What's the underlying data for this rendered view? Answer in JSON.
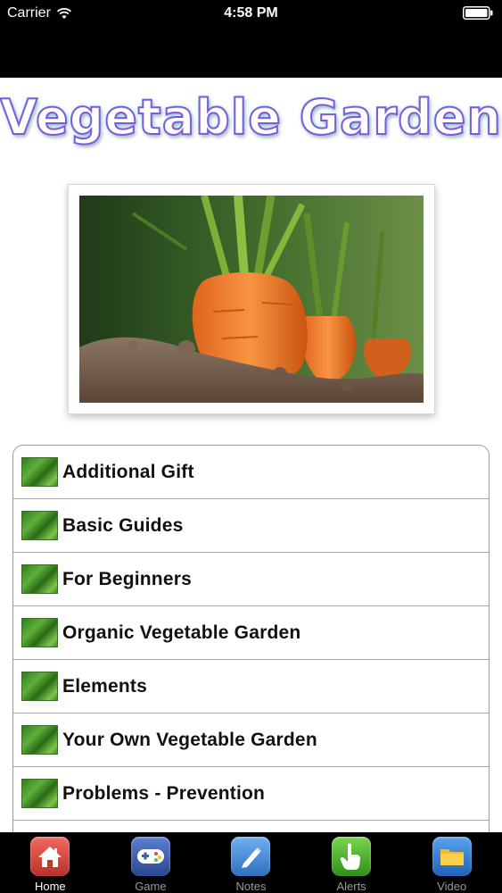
{
  "status_bar": {
    "carrier": "Carrier",
    "time": "4:58 PM"
  },
  "header": {
    "title": "Vegetable Garden"
  },
  "menu": {
    "items": [
      {
        "label": "Additional Gift",
        "icon": "garden-thumbnail"
      },
      {
        "label": "Basic Guides",
        "icon": "garden-thumbnail"
      },
      {
        "label": "For Beginners",
        "icon": "garden-thumbnail"
      },
      {
        "label": "Organic Vegetable Garden",
        "icon": "garden-thumbnail"
      },
      {
        "label": "Elements",
        "icon": "garden-thumbnail"
      },
      {
        "label": "Your Own Vegetable Garden",
        "icon": "garden-thumbnail"
      },
      {
        "label": "Problems - Prevention",
        "icon": "garden-thumbnail"
      }
    ]
  },
  "tab_bar": {
    "tabs": [
      {
        "label": "Home",
        "icon": "house-icon",
        "color": "#d9423a",
        "active": true
      },
      {
        "label": "Game",
        "icon": "gamepad-icon",
        "color": "#3b5fb0",
        "active": false
      },
      {
        "label": "Notes",
        "icon": "pen-icon",
        "color": "#3f86d6",
        "active": false
      },
      {
        "label": "Alerts",
        "icon": "hand-pointer-icon",
        "color": "#4caf2a",
        "active": false
      },
      {
        "label": "Video",
        "icon": "folder-icon",
        "color": "#2f7fd8",
        "active": false
      }
    ]
  }
}
